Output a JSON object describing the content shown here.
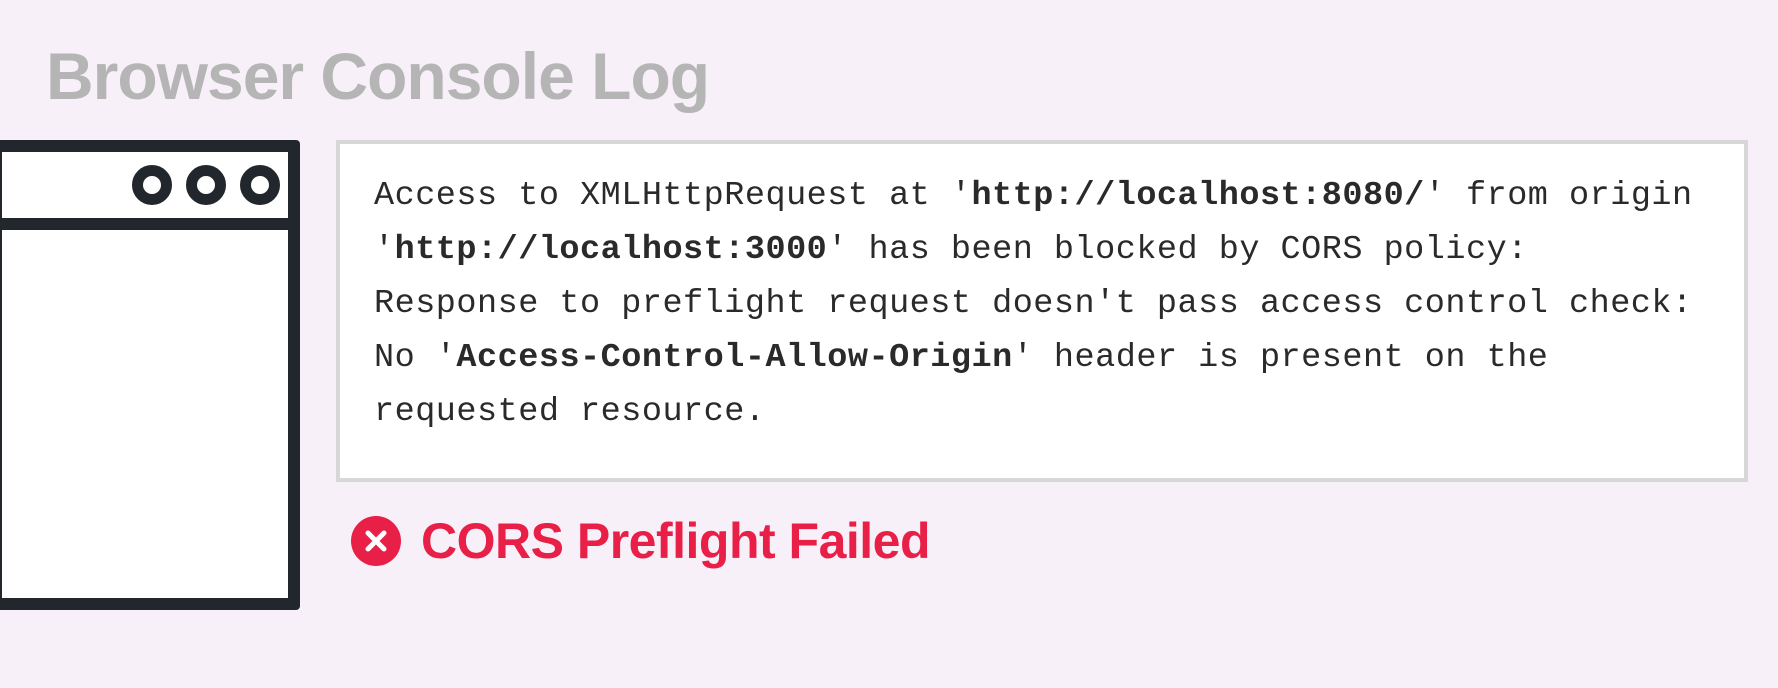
{
  "title": "Browser Console Log",
  "log": {
    "p1": "Access to XMLHttpRequest at '",
    "b1": "http://localhost:8080/",
    "p2": "' from origin '",
    "b2": "http://localhost:3000",
    "p3": "' has been blocked by CORS policy: Response to preflight request doesn't pass access control check: No '",
    "b3": "Access-Control-Allow-Origin",
    "p4": "' header is present on the requested resource."
  },
  "status": {
    "label": "CORS Preflight Failed"
  }
}
